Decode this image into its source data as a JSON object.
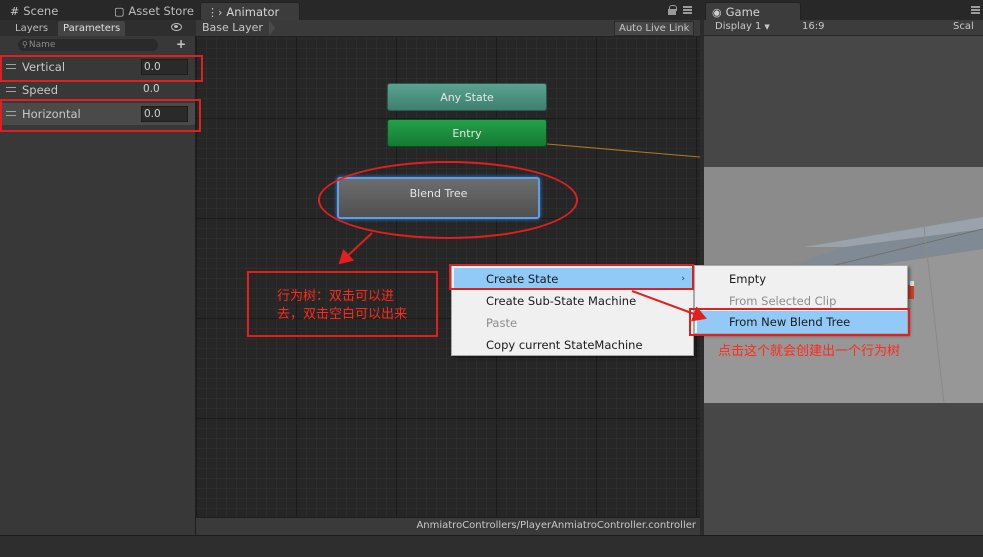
{
  "tabs": [
    {
      "label": "Scene",
      "icon": "grid-icon"
    },
    {
      "label": "Asset Store",
      "icon": "store-icon"
    },
    {
      "label": "Animator",
      "icon": "animator-icon"
    },
    {
      "label": "Game",
      "icon": "game-icon"
    }
  ],
  "left_panel": {
    "tabs": [
      "Layers",
      "Parameters"
    ],
    "search_placeholder": "Name",
    "parameters": [
      {
        "name": "Vertical",
        "value": "0.0"
      },
      {
        "name": "Speed",
        "value": "0.0"
      },
      {
        "name": "Horizontal",
        "value": "0.0"
      }
    ]
  },
  "graph": {
    "breadcrumb": "Base Layer",
    "auto_live_link": "Auto Live Link",
    "nodes": {
      "any_state": "Any State",
      "entry": "Entry",
      "blend_tree": "Blend Tree"
    },
    "status_path": "AnmiatroControllers/PlayerAnmiatroController.controller"
  },
  "game": {
    "display": "Display 1",
    "aspect": "16:9",
    "scale": "Scal"
  },
  "context_menu": {
    "items": [
      {
        "label": "Create State",
        "highlighted": true,
        "disabled": false,
        "submenu": true
      },
      {
        "label": "Create Sub-State Machine",
        "highlighted": false,
        "disabled": false
      },
      {
        "label": "Paste",
        "highlighted": false,
        "disabled": true
      },
      {
        "label": "Copy current StateMachine",
        "highlighted": false,
        "disabled": false
      }
    ],
    "submenu": [
      {
        "label": "Empty",
        "highlighted": false,
        "disabled": false
      },
      {
        "label": "From Selected Clip",
        "highlighted": false,
        "disabled": true
      },
      {
        "label": "From New Blend Tree",
        "highlighted": true,
        "disabled": false
      }
    ]
  },
  "annotations": {
    "note_blend_line1": "行为树：双击可以进",
    "note_blend_line2": "去，双击空白可以出来",
    "note_submenu": "点击这个就会创建出一个行为树"
  },
  "colors": {
    "any_state": "#4f9583",
    "entry": "#1c8e40",
    "selection_outline": "#5c9fe8",
    "menu_highlight": "#91c9f7",
    "annotation": "#e0201e"
  }
}
